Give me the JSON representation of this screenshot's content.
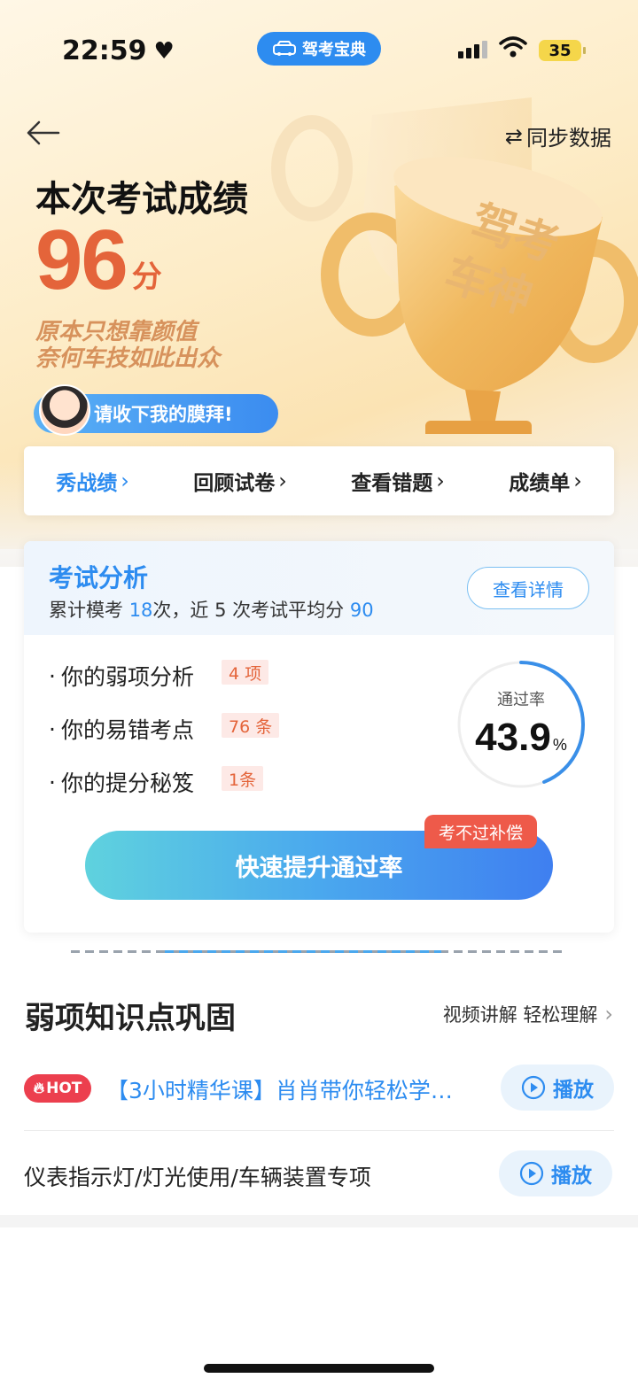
{
  "status": {
    "time": "22:59",
    "battery": "35",
    "app_pill": "驾考宝典"
  },
  "header": {
    "sync_label": "同步数据"
  },
  "hero": {
    "title": "本次考试成绩",
    "score": "96",
    "score_unit": "分",
    "slogan_line1": "原本只想靠颜值",
    "slogan_line2": "奈何车技如此出众",
    "bow_text": "请收下我的膜拜!",
    "trophy_text_1": "驾考",
    "trophy_text_2": "车神"
  },
  "nav": {
    "items": [
      {
        "label": "秀战绩"
      },
      {
        "label": "回顾试卷"
      },
      {
        "label": "查看错题"
      },
      {
        "label": "成绩单"
      }
    ]
  },
  "analysis": {
    "title": "考试分析",
    "sub_pre": "累计模考",
    "count": "18",
    "sub_mid": "次，近",
    "recent": "5",
    "sub_mid2": "次考试平均分",
    "avg": "90",
    "detail_label": "查看详情",
    "rows": [
      {
        "label": "你的弱项分析",
        "tag": "4 项"
      },
      {
        "label": "你的易错考点",
        "tag": "76 条"
      },
      {
        "label": "你的提分秘笈",
        "tag": "1条"
      }
    ],
    "gauge_label": "通过率",
    "pass_rate": "43.9",
    "pass_rate_unit": "%",
    "pass_rate_fraction": 0.439,
    "boost_label": "快速提升通过率",
    "guarantee_label": "考不过补偿"
  },
  "weak": {
    "title": "弱项知识点巩固",
    "more_label": "视频讲解 轻松理解",
    "hot_label": "HOT",
    "course1": "【3小时精华课】肖肖带你轻松学…",
    "course2": "仪表指示灯/灯光使用/车辆装置专项",
    "play_label": "播放"
  },
  "colors": {
    "accent": "#2d8cf0",
    "score": "#e4643a",
    "hot": "#ec3f4e"
  }
}
